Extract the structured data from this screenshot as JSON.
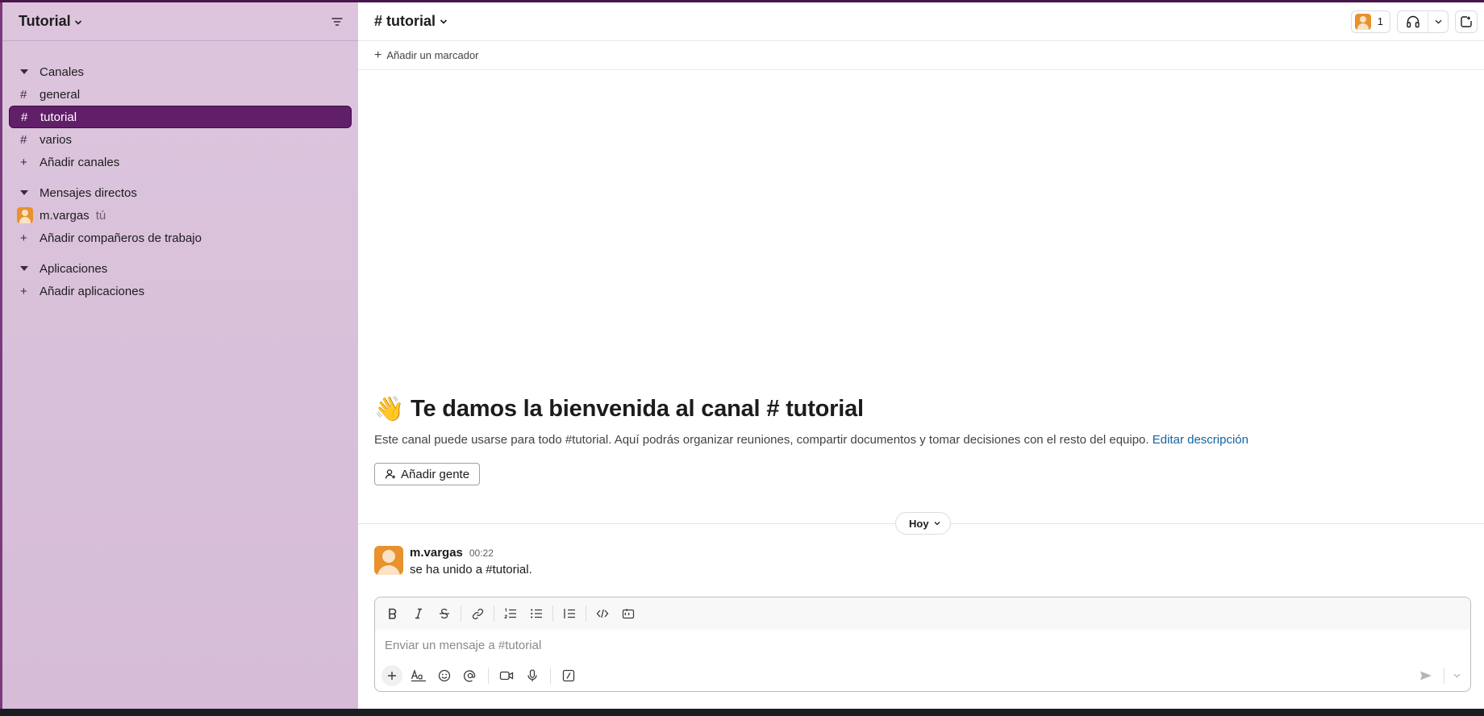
{
  "workspace": {
    "name": "Tutorial"
  },
  "sidebar": {
    "channels_section": "Canales",
    "channels": [
      {
        "name": "general"
      },
      {
        "name": "tutorial"
      },
      {
        "name": "varios"
      }
    ],
    "add_channels": "Añadir canales",
    "dm_section": "Mensajes directos",
    "dm_user": {
      "name": "m.vargas",
      "tag": "tú"
    },
    "add_coworkers": "Añadir compañeros de trabajo",
    "apps_section": "Aplicaciones",
    "add_apps": "Añadir aplicaciones"
  },
  "channel": {
    "hash": "#",
    "name": "tutorial",
    "member_count": "1",
    "add_bookmark": "Añadir un marcador"
  },
  "welcome": {
    "emoji": "👋",
    "heading_prefix": "Te damos la bienvenida al canal",
    "heading_channel": "tutorial",
    "description": "Este canal puede usarse para todo #tutorial. Aquí podrás organizar reuniones, compartir documentos y tomar decisiones con el resto del equipo.",
    "edit_link": "Editar descripción",
    "add_people": "Añadir gente"
  },
  "day_divider": "Hoy",
  "messages": [
    {
      "author": "m.vargas",
      "time": "00:22",
      "text": "se ha unido a #tutorial."
    }
  ],
  "composer": {
    "placeholder": "Enviar un mensaje a #tutorial"
  },
  "colors": {
    "sidebar_bg": "#d8c0d9",
    "active_channel": "#611f69",
    "link": "#1264a3",
    "avatar": "#e8912d",
    "presence": "#2bac76"
  }
}
